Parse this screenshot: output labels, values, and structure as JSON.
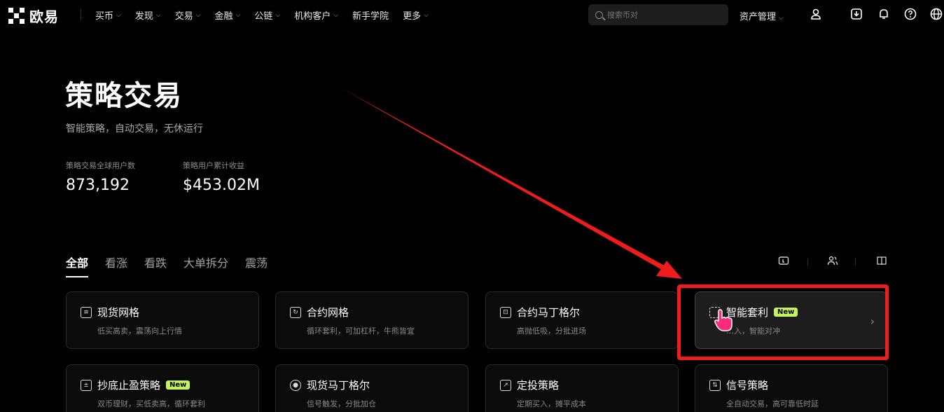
{
  "nav": {
    "logo_text": "欧易",
    "menu": [
      {
        "label": "买币",
        "dropdown": true
      },
      {
        "label": "发现",
        "dropdown": true
      },
      {
        "label": "交易",
        "dropdown": true
      },
      {
        "label": "金融",
        "dropdown": true
      },
      {
        "label": "公链",
        "dropdown": true
      },
      {
        "label": "机构客户",
        "dropdown": true
      },
      {
        "label": "新手学院",
        "dropdown": false
      },
      {
        "label": "更多",
        "dropdown": true
      }
    ],
    "search_placeholder": "搜索币对",
    "asset_label": "资产管理",
    "icons": [
      "user-icon",
      "download-icon",
      "bell-icon",
      "help-icon",
      "globe-icon"
    ]
  },
  "hero": {
    "title": "策略交易",
    "subtitle": "智能策略，自动交易，无休运行",
    "stats": [
      {
        "label": "策略交易全球用户数",
        "value": "873,192"
      },
      {
        "label": "策略用户累计收益",
        "value": "$453.02M"
      }
    ]
  },
  "tabs": {
    "items": [
      "全部",
      "看涨",
      "看跌",
      "大单拆分",
      "震荡"
    ],
    "active": "全部"
  },
  "toolbar_icons": [
    "card-view-icon",
    "users-icon",
    "book-icon"
  ],
  "cards": [
    {
      "name": "现货网格",
      "desc": "低买高卖，震荡向上行情",
      "icon": "grid-icon",
      "badge": ""
    },
    {
      "name": "合约网格",
      "desc": "循环套利，可加杠杆，牛熊皆宜",
      "icon": "contract-grid-icon",
      "badge": ""
    },
    {
      "name": "合约马丁格尔",
      "desc": "高抛低吸，分批进场",
      "icon": "martingale-icon",
      "badge": ""
    },
    {
      "name": "智能套利",
      "desc": "…入，智能对冲",
      "icon": "arbitrage-icon",
      "badge": "New"
    },
    {
      "name": "抄底止盈策略",
      "desc": "双币理财，买低卖高，循环套利",
      "icon": "dip-icon",
      "badge": "New"
    },
    {
      "name": "现货马丁格尔",
      "desc": "信号触发，分批加仓",
      "icon": "spot-martingale-icon",
      "badge": ""
    },
    {
      "name": "定投策略",
      "desc": "定期买入，摊平成本",
      "icon": "dca-icon",
      "badge": ""
    },
    {
      "name": "信号策略",
      "desc": "全自动交易，高可靠低时延",
      "icon": "signal-icon",
      "badge": ""
    }
  ],
  "colors": {
    "background": "#000000",
    "badge": "#c6f25a",
    "annotation": "#ee1c1c"
  }
}
